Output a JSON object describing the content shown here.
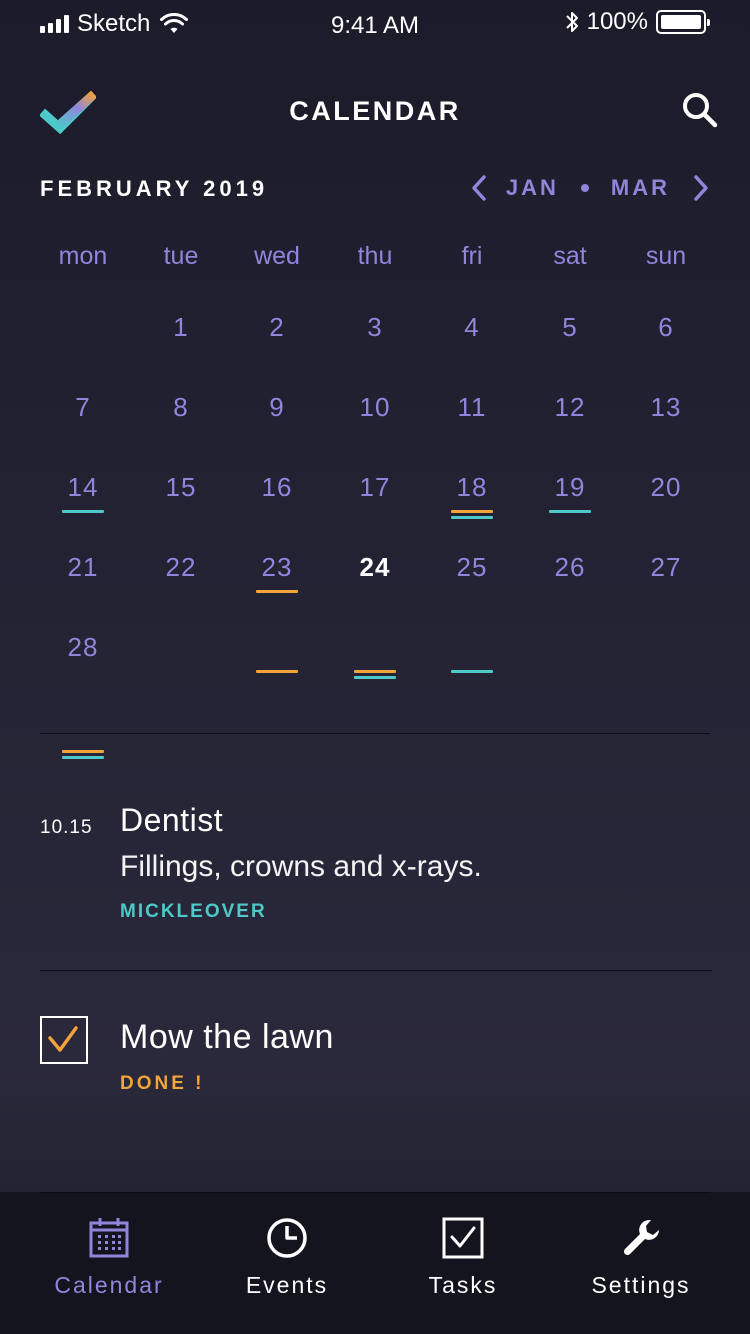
{
  "status_bar": {
    "carrier": "Sketch",
    "time": "9:41 AM",
    "battery": "100%"
  },
  "header": {
    "title": "CALENDAR"
  },
  "month_nav": {
    "current": "FEBRUARY 2019",
    "prev": "JAN",
    "next": "MAR"
  },
  "calendar": {
    "weekdays": [
      "mon",
      "tue",
      "wed",
      "thu",
      "fri",
      "sat",
      "sun"
    ],
    "days": [
      "1",
      "2",
      "3",
      "4",
      "5",
      "6",
      "7",
      "8",
      "9",
      "10",
      "11",
      "12",
      "13",
      "14",
      "15",
      "16",
      "17",
      "18",
      "19",
      "20",
      "21",
      "22",
      "23",
      "24",
      "25",
      "26",
      "27",
      "28"
    ],
    "today": "24",
    "event_markers": {
      "7": [
        "teal"
      ],
      "11": [
        "orange",
        "teal"
      ],
      "12": [
        "teal"
      ],
      "16": [
        "orange"
      ],
      "23": [
        "orange"
      ],
      "24": [
        "orange",
        "teal"
      ],
      "25": [
        "teal"
      ],
      "28": [
        "orange",
        "teal"
      ]
    },
    "colors": {
      "orange": "#f2a33a",
      "teal": "#4dc9c9",
      "accent": "#8f86dc"
    }
  },
  "event": {
    "time": "10.15",
    "title": "Dentist",
    "description": "Fillings, crowns and x-rays.",
    "location": "MICKLEOVER"
  },
  "task": {
    "title": "Mow the lawn",
    "status": "DONE !",
    "checked": true
  },
  "tabbar": {
    "items": [
      {
        "label": "Calendar",
        "icon": "calendar-icon",
        "active": true
      },
      {
        "label": "Events",
        "icon": "clock-icon",
        "active": false
      },
      {
        "label": "Tasks",
        "icon": "checkbox-icon",
        "active": false
      },
      {
        "label": "Settings",
        "icon": "wrench-icon",
        "active": false
      }
    ]
  }
}
